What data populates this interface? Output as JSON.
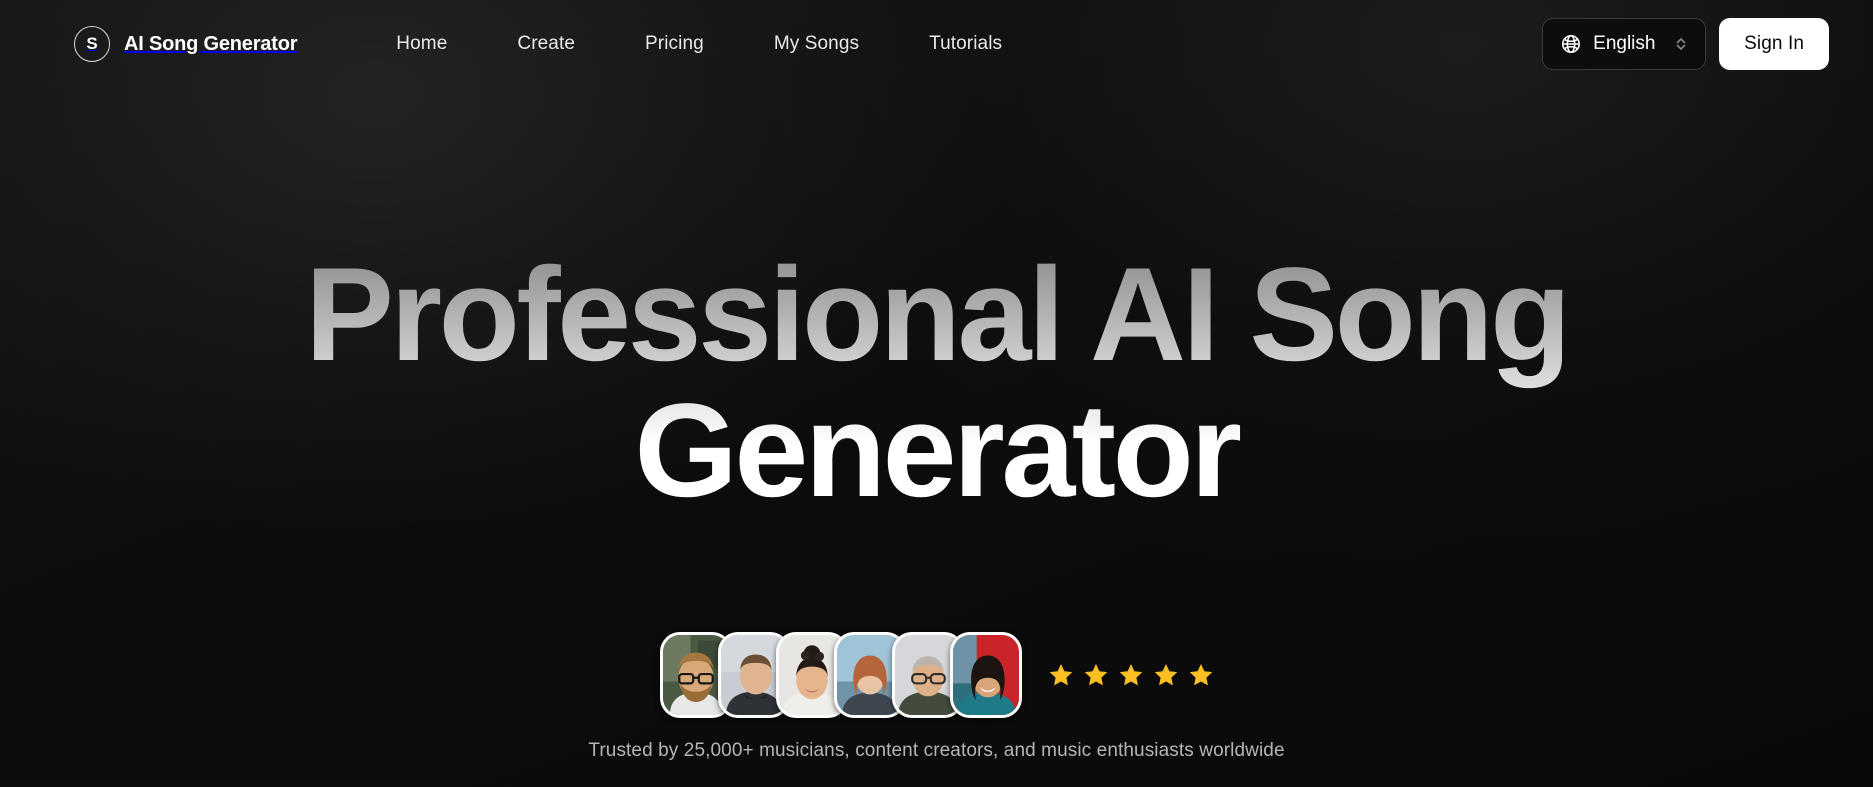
{
  "brand": {
    "badge_letter": "S",
    "name": "AI Song Generator",
    "badge_icon": "circle-s-logo-icon"
  },
  "nav": {
    "links": [
      {
        "label": "Home"
      },
      {
        "label": "Create"
      },
      {
        "label": "Pricing"
      },
      {
        "label": "My Songs"
      },
      {
        "label": "Tutorials"
      }
    ],
    "language": {
      "selected": "English",
      "globe_icon": "globe-icon",
      "chevron_icon": "chevron-up-down-icon"
    },
    "sign_in_label": "Sign In"
  },
  "hero": {
    "title_line1": "Professional AI Song",
    "title_line2": "Generator"
  },
  "social_proof": {
    "avatar_count": 6,
    "avatars": [
      {
        "alt": "avatar-bearded-man-glasses",
        "bg": "#4a5a42",
        "skin": "#d9a878",
        "hair": "#a5773f",
        "shirt": "#e8e8e8"
      },
      {
        "alt": "avatar-young-man-dark-shirt",
        "bg": "#c9ccd2",
        "skin": "#e0b48e",
        "hair": "#6b4f35",
        "shirt": "#2e3136"
      },
      {
        "alt": "avatar-woman-bun-hairstyle",
        "bg": "#e8e6e2",
        "skin": "#e5b58d",
        "hair": "#231a15",
        "shirt": "#f0eeea"
      },
      {
        "alt": "avatar-red-haired-woman",
        "bg": "#9fc4d8",
        "skin": "#e8c3a4",
        "hair": "#b4663a",
        "shirt": "#3e4750"
      },
      {
        "alt": "avatar-older-man-glasses",
        "bg": "#d5d7da",
        "skin": "#ddb08a",
        "hair": "#b9b4ae",
        "shirt": "#424b3c"
      },
      {
        "alt": "avatar-smiling-woman-red-bg",
        "bg": "#c9242a",
        "skin": "#d9a478",
        "hair": "#1c1410",
        "shirt": "#1f7a88"
      }
    ],
    "star_count": 5,
    "star_icon": "star-filled-icon",
    "star_color": "#FBBF24",
    "trusted_text": "Trusted by 25,000+ musicians, content creators, and music enthusiasts worldwide"
  },
  "theme": {
    "background": "#0a0a0a",
    "accent_white": "#ffffff",
    "muted_text": "#b5b5b5",
    "star_gold": "#FBBF24"
  }
}
